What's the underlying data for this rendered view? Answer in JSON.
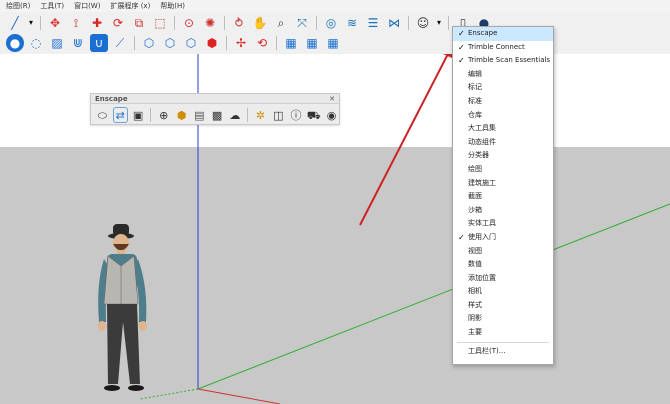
{
  "menubar": {
    "items": [
      "绘图(R)",
      "工具(T)",
      "窗口(W)",
      "扩展程序 (x)",
      "帮助(H)"
    ]
  },
  "toolbar_top": {
    "icons": [
      "line-tool",
      "dropdown",
      "eraser-tool",
      "tape-tool",
      "move-tool",
      "rotate-tool",
      "scale-tool",
      "camera-tool",
      "orbit-tool",
      "pan-tool",
      "zoom-tool",
      "zoom-extents-tool",
      "walk-tool",
      "section-tool",
      "layers-tool",
      "components-tool",
      "user-tool",
      "new-file",
      "person"
    ]
  },
  "toolbar_second": {
    "icons": [
      "drop-icon",
      "drop-outline-icon",
      "paint-icon",
      "magnet-icon",
      "u-magnet-icon",
      "node-icon",
      "hex-1",
      "hex-2",
      "hex-3",
      "hex-4",
      "red-move",
      "rotate-arrows",
      "grid-1",
      "grid-2",
      "grid-3"
    ]
  },
  "enscape": {
    "title": "Enscape",
    "icons": [
      "enscape-start",
      "enscape-sync",
      "enscape-capture",
      "enscape-plus",
      "enscape-assets",
      "enscape-materials",
      "enscape-checker",
      "enscape-cloud",
      "enscape-settings",
      "enscape-export",
      "enscape-info",
      "enscape-cart",
      "enscape-user"
    ]
  },
  "context_menu": {
    "items": [
      {
        "label": "Enscape",
        "checked": true
      },
      {
        "label": "Trimble Connect",
        "checked": true
      },
      {
        "label": "Trimble Scan Essentials",
        "checked": true
      },
      {
        "label": "编辑",
        "checked": false
      },
      {
        "label": "标记",
        "checked": false
      },
      {
        "label": "标准",
        "checked": false
      },
      {
        "label": "仓库",
        "checked": false
      },
      {
        "label": "大工具集",
        "checked": false
      },
      {
        "label": "动态组件",
        "checked": false
      },
      {
        "label": "分类器",
        "checked": false
      },
      {
        "label": "绘图",
        "checked": false
      },
      {
        "label": "建筑施工",
        "checked": false
      },
      {
        "label": "截面",
        "checked": false
      },
      {
        "label": "沙箱",
        "checked": false
      },
      {
        "label": "实体工具",
        "checked": false
      },
      {
        "label": "使用入门",
        "checked": true
      },
      {
        "label": "视图",
        "checked": false
      },
      {
        "label": "数值",
        "checked": false
      },
      {
        "label": "添加位置",
        "checked": false
      },
      {
        "label": "相机",
        "checked": false
      },
      {
        "label": "样式",
        "checked": false
      },
      {
        "label": "阴影",
        "checked": false
      },
      {
        "label": "主要",
        "checked": false
      }
    ],
    "footer": "工具栏(T)..."
  },
  "colors": {
    "axis_blue": "#2a3fd6",
    "axis_green": "#2fae2f",
    "axis_red": "#d13030",
    "arrow_red": "#cc2222",
    "ground": "#c8c8c8",
    "highlight": "#cce8ff"
  }
}
